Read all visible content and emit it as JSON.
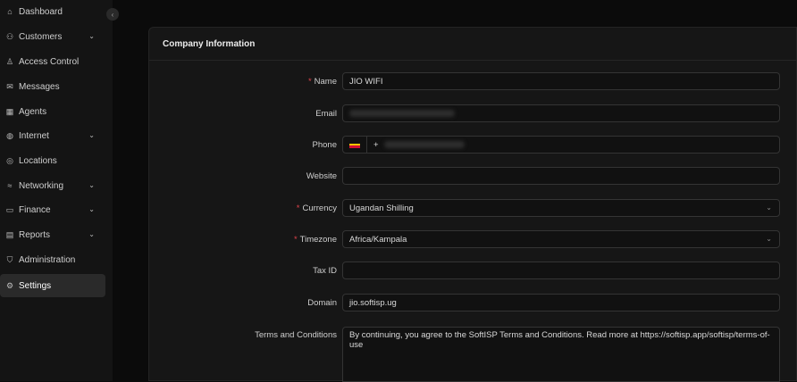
{
  "sidebar": {
    "items": [
      {
        "label": "Dashboard",
        "icon": "home-icon",
        "glyph": "⌂",
        "has_chevron": false,
        "active": false
      },
      {
        "label": "Customers",
        "icon": "users-icon",
        "glyph": "⚇",
        "has_chevron": true,
        "active": false
      },
      {
        "label": "Access Control",
        "icon": "user-icon",
        "glyph": "♙",
        "has_chevron": false,
        "active": false
      },
      {
        "label": "Messages",
        "icon": "mail-icon",
        "glyph": "✉",
        "has_chevron": false,
        "active": false
      },
      {
        "label": "Agents",
        "icon": "building-icon",
        "glyph": "▦",
        "has_chevron": false,
        "active": false
      },
      {
        "label": "Internet",
        "icon": "globe-icon",
        "glyph": "◍",
        "has_chevron": true,
        "active": false
      },
      {
        "label": "Locations",
        "icon": "location-icon",
        "glyph": "◎",
        "has_chevron": false,
        "active": false
      },
      {
        "label": "Networking",
        "icon": "wifi-icon",
        "glyph": "≈",
        "has_chevron": true,
        "active": false
      },
      {
        "label": "Finance",
        "icon": "wallet-icon",
        "glyph": "▭",
        "has_chevron": true,
        "active": false
      },
      {
        "label": "Reports",
        "icon": "file-icon",
        "glyph": "▤",
        "has_chevron": true,
        "active": false
      },
      {
        "label": "Administration",
        "icon": "shield-icon",
        "glyph": "⛉",
        "has_chevron": false,
        "active": false
      },
      {
        "label": "Settings",
        "icon": "gear-icon",
        "glyph": "⚙",
        "has_chevron": false,
        "active": true
      }
    ],
    "collapse_glyph": "‹"
  },
  "panel": {
    "title": "Company Information"
  },
  "form": {
    "name": {
      "label": "Name",
      "value": "JIO WIFI",
      "required": true
    },
    "email": {
      "label": "Email",
      "value": "",
      "required": false
    },
    "phone": {
      "label": "Phone",
      "prefix": "+",
      "country_flag": "uganda-flag-icon",
      "required": false
    },
    "website": {
      "label": "Website",
      "value": "",
      "required": false
    },
    "currency": {
      "label": "Currency",
      "value": "Ugandan Shilling",
      "required": true
    },
    "timezone": {
      "label": "Timezone",
      "value": "Africa/Kampala",
      "required": true
    },
    "tax_id": {
      "label": "Tax ID",
      "value": "",
      "required": false
    },
    "domain": {
      "label": "Domain",
      "value": "jio.softisp.ug",
      "required": false
    },
    "terms": {
      "label": "Terms and Conditions",
      "value": "By continuing, you agree to the SoftISP Terms and Conditions. Read more at https://softisp.app/softisp/terms-of-use"
    }
  },
  "colors": {
    "required_star": "#e0434b",
    "accent_bg": "#2a2a2a"
  },
  "glyphs": {
    "chevron": "⌄",
    "required": "*"
  }
}
